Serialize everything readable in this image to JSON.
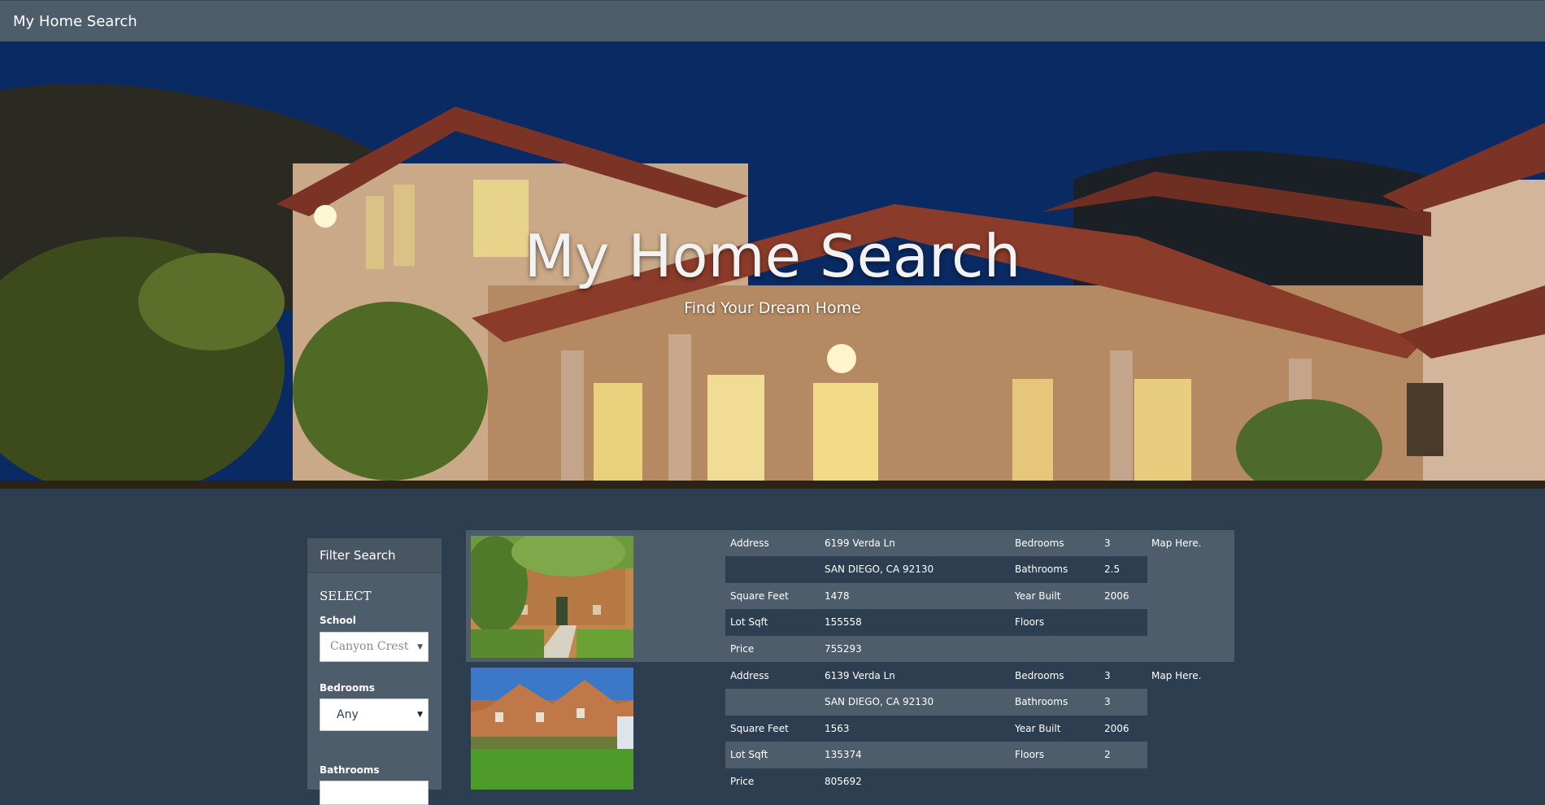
{
  "navbar": {
    "brand": "My Home Search"
  },
  "hero": {
    "title": "My Home Search",
    "subtitle": "Find Your Dream Home"
  },
  "filter": {
    "heading": "Filter Search",
    "select_title": "SELECT",
    "school": {
      "label": "School",
      "value": "Canyon Crest"
    },
    "bedrooms": {
      "label": "Bedrooms",
      "value": "Any"
    },
    "bathrooms": {
      "label": "Bathrooms",
      "value": ""
    }
  },
  "listings": [
    {
      "address_label": "Address",
      "address_line1": "6199 Verda Ln",
      "address_line2": "SAN DIEGO, CA 92130",
      "sqft_label": "Square Feet",
      "sqft": "1478",
      "lot_label": "Lot Sqft",
      "lot": "155558",
      "price_label": "Price",
      "price": "755293",
      "bedrooms_label": "Bedrooms",
      "bedrooms": "3",
      "bathrooms_label": "Bathrooms",
      "bathrooms": "2.5",
      "year_label": "Year Built",
      "year": "2006",
      "floors_label": "Floors",
      "floors": "",
      "map": "Map Here."
    },
    {
      "address_label": "Address",
      "address_line1": "6139 Verda Ln",
      "address_line2": "SAN DIEGO, CA 92130",
      "sqft_label": "Square Feet",
      "sqft": "1563",
      "lot_label": "Lot Sqft",
      "lot": "135374",
      "price_label": "Price",
      "price": "805692",
      "bedrooms_label": "Bedrooms",
      "bedrooms": "3",
      "bathrooms_label": "Bathrooms",
      "bathrooms": "3",
      "year_label": "Year Built",
      "year": "2006",
      "floors_label": "Floors",
      "floors": "2",
      "map": "Map Here."
    }
  ],
  "colors": {
    "navbar": "#4e5d6c",
    "background": "#2c3e50",
    "panel": "#4e5d6c"
  }
}
